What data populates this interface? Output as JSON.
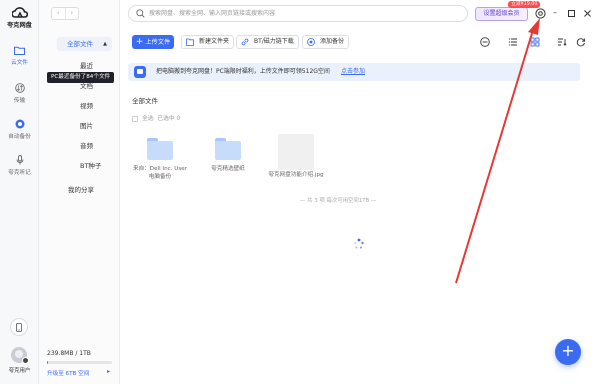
{
  "app": {
    "logo_text": "夸克网盘",
    "user_name": "夸克用户"
  },
  "rail": {
    "items": [
      {
        "label": "云文件",
        "icon": "folder-icon",
        "active": true
      },
      {
        "label": "传输",
        "icon": "transfer-icon",
        "active": false
      },
      {
        "label": "自动备份",
        "icon": "backup-icon",
        "active": false
      },
      {
        "label": "夸克听记",
        "icon": "microphone-icon",
        "active": false
      }
    ]
  },
  "sidebar": {
    "all_files": "全部文件",
    "categories": [
      "最近",
      "文档",
      "视频",
      "图片",
      "音频",
      "BT种子"
    ],
    "my_share": "我的分享",
    "storage_text": "239.8MB / 1TB",
    "storage_used_fraction": 0.0003,
    "upgrade_text": "升级至 6TB 空间",
    "tooltip": "PC最近备份了84个文件"
  },
  "topbar": {
    "search_placeholder": "搜索网盘、搜索全网、输入网页链接或搜索内容",
    "vip_button": "设置超级会员",
    "vip_tag": "立减¥19.00"
  },
  "toolbar": {
    "upload": "上传文件",
    "new_folder": "新建文件夹",
    "bt_download": "BT/磁力链下载",
    "add_backup": "添加备份"
  },
  "banner": {
    "text": "把电脑搬到夸克网盘！PC端限时福利，上传文件即可领512G空间",
    "link": "点击参加"
  },
  "main": {
    "section_title": "全部文件",
    "select_all": "全选",
    "selected_count": "已选中 0",
    "files": [
      {
        "name": "来自：Dell Inc. User 电脑备份",
        "type": "folder"
      },
      {
        "name": "夸克精选壁纸",
        "type": "folder"
      },
      {
        "name": "夸克网盘功能介绍.jpg",
        "type": "image"
      }
    ],
    "footnote": "— 共 3 项 每次可用空间1TB —"
  },
  "colors": {
    "accent": "#3a6bf0",
    "annotation": "#e53935"
  }
}
